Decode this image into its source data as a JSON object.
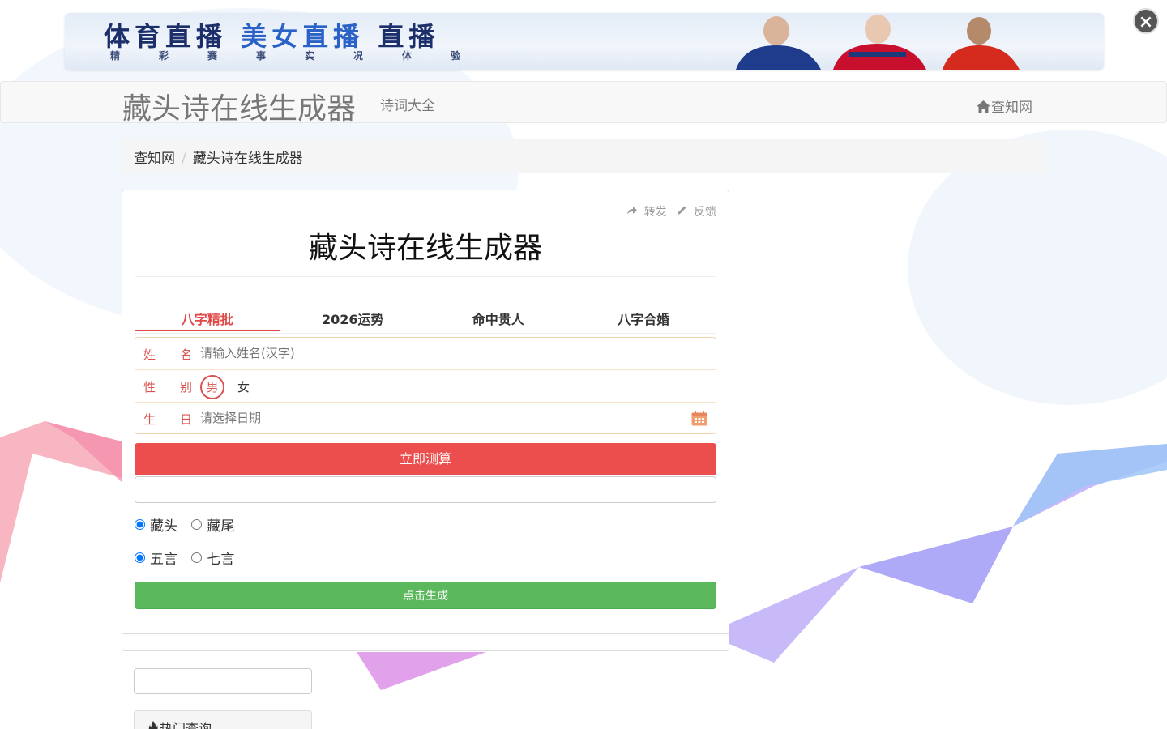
{
  "banner": {
    "title_part1": "体育直播",
    "title_part2": "美女直播",
    "title_part3": "直播",
    "subtitle": "精彩赛事实况体验",
    "close_label": "×"
  },
  "navbar": {
    "brand": "藏头诗在线生成器",
    "link": "诗词大全",
    "home": "查知网"
  },
  "breadcrumb": {
    "home": "查知网",
    "separator": "/",
    "current": "藏头诗在线生成器"
  },
  "panel": {
    "share": "转发",
    "feedback": "反馈",
    "title": "藏头诗在线生成器",
    "tabs": [
      "八字精批",
      "2026运势",
      "命中贵人",
      "八字合婚"
    ],
    "form": {
      "name_label": "姓名",
      "name_placeholder": "请输入姓名(汉字)",
      "gender_label": "性别",
      "gender_male": "男",
      "gender_female": "女",
      "birth_label": "生日",
      "birth_placeholder": "请选择日期"
    },
    "calc_button": "立即测算",
    "position_options": [
      "藏头",
      "藏尾"
    ],
    "length_options": [
      "五言",
      "七言"
    ],
    "generate_button": "点击生成"
  },
  "sidebar": {
    "hot_title": "热门查询"
  },
  "colors": {
    "accent_red": "#ec4d4d",
    "accent_green": "#5cb85c"
  }
}
